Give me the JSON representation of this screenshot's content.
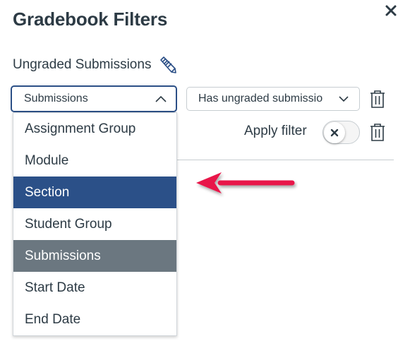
{
  "header": {
    "title": "Gradebook Filters",
    "close_icon": "close-icon"
  },
  "filter": {
    "name": "Ungraded Submissions",
    "edit_icon": "pencil-icon",
    "type_select": {
      "value": "Submissions",
      "expanded": true
    },
    "value_select": {
      "value": "Has ungraded submissions",
      "display": "Has ungraded submissio"
    },
    "apply_label": "Apply filter",
    "apply_enabled": false
  },
  "menu": {
    "items": [
      {
        "label": "Assignment Group",
        "state": "normal"
      },
      {
        "label": "Module",
        "state": "normal"
      },
      {
        "label": "Section",
        "state": "highlighted"
      },
      {
        "label": "Student Group",
        "state": "normal"
      },
      {
        "label": "Submissions",
        "state": "selected"
      },
      {
        "label": "Start Date",
        "state": "normal"
      },
      {
        "label": "End Date",
        "state": "normal"
      }
    ]
  },
  "annotation": {
    "type": "arrow",
    "points_to": "Section",
    "color": "#e8174a"
  },
  "colors": {
    "text": "#2d3b45",
    "focus_border": "#2b4f86",
    "highlight": "#2b5088",
    "selected": "#6b7780",
    "border": "#c7cdd1"
  }
}
